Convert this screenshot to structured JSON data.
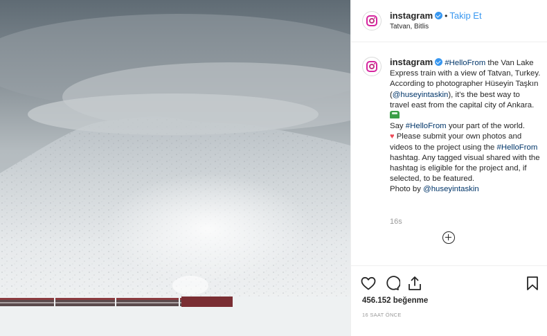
{
  "header": {
    "username": "instagram",
    "separator": "•",
    "follow_label": "Takip Et",
    "location": "Tatvan, Bitlis"
  },
  "caption": {
    "username": "instagram",
    "hashtag_hello": "#HelloFrom",
    "part1": " the Van Lake Express train with a view of Tatvan, Turkey. According to photographer Hüseyin Taşkın (",
    "mention": "@huseyintaskin",
    "part2": "), it's the best way to travel east from the capital city of Ankara. ",
    "say": "Say ",
    "hashtag_hello_2": "#HelloFrom",
    "part3": " your part of the world.",
    "heart": "♥",
    "part4": " Please submit your own photos and videos to the project using the ",
    "hashtag_hello_3": "#HelloFrom",
    "part5": " hashtag. Any tagged visual shared with the hashtag is eligible for the project and, if selected, to be featured.",
    "photo_by": "Photo by ",
    "mention_2": "@huseyintaskin",
    "time_ago": "16s"
  },
  "icons": {
    "logo": "instagram-logo-icon",
    "verified": "verified-badge-icon",
    "train_emoji": "train-emoji-icon",
    "heart_emoji": "red-heart-icon",
    "load_more": "plus-circle-icon",
    "like": "heart-outline-icon",
    "comment": "comment-bubble-icon",
    "share": "share-arrow-icon",
    "save": "bookmark-icon"
  },
  "stats": {
    "likes": "456.152 beğenme",
    "timestamp": "16 SAAT ÖNCE"
  },
  "colors": {
    "link_blue": "#3897f0",
    "hashtag": "#003569",
    "muted": "#999999",
    "heart_red": "#ed4956"
  }
}
